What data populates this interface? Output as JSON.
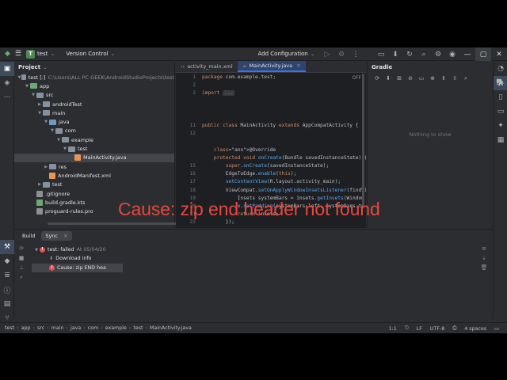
{
  "titlebar": {
    "project_badge": "T",
    "project_name": "test",
    "vcs": "Version Control",
    "run_config": "Add Configuration"
  },
  "project_panel": {
    "title": "Project",
    "tree": [
      {
        "label": "test [:]",
        "path": "C:\\Users\\ALL PC GEEK\\AndroidStudioProjects\\test",
        "indent": 0,
        "chevron": "▼",
        "icon": "folder"
      },
      {
        "label": "app",
        "indent": 1,
        "chevron": "▼",
        "icon": "folder-green"
      },
      {
        "label": "src",
        "indent": 2,
        "chevron": "▼",
        "icon": "folder"
      },
      {
        "label": "androidTest",
        "indent": 3,
        "chevron": "▶",
        "icon": "folder"
      },
      {
        "label": "main",
        "indent": 3,
        "chevron": "▼",
        "icon": "folder"
      },
      {
        "label": "java",
        "indent": 4,
        "chevron": "▼",
        "icon": "folder-blue"
      },
      {
        "label": "com",
        "indent": 5,
        "chevron": "▼",
        "icon": "folder"
      },
      {
        "label": "example",
        "indent": 6,
        "chevron": "▼",
        "icon": "folder"
      },
      {
        "label": "test",
        "indent": 7,
        "chevron": "▼",
        "icon": "folder"
      },
      {
        "label": "MainActivity.java",
        "indent": 8,
        "chevron": "",
        "icon": "java-file",
        "selected": true
      },
      {
        "label": "res",
        "indent": 4,
        "chevron": "▶",
        "icon": "folder"
      },
      {
        "label": "AndroidManifest.xml",
        "indent": 4,
        "chevron": "",
        "icon": "xml-file"
      },
      {
        "label": "test",
        "indent": 3,
        "chevron": "▶",
        "icon": "folder"
      },
      {
        "label": ".gitignore",
        "indent": 2,
        "chevron": "",
        "icon": "text-file"
      },
      {
        "label": "build.gradle.kts",
        "indent": 2,
        "chevron": "",
        "icon": "gradle-file"
      },
      {
        "label": "proguard-rules.pro",
        "indent": 2,
        "chevron": "",
        "icon": "text-file"
      }
    ]
  },
  "editor": {
    "tabs": [
      {
        "label": "activity_main.xml",
        "active": false
      },
      {
        "label": "MainActivity.java",
        "active": true
      }
    ],
    "off_label": "OFF",
    "line_numbers": [
      "1",
      "2",
      "3",
      "",
      "",
      "",
      "11",
      "12",
      "",
      "",
      "",
      "15",
      "16",
      "17",
      "18",
      "19",
      "20",
      "21",
      "22"
    ],
    "lines": [
      "package com.example.test;",
      "",
      "import ...",
      "",
      "",
      "",
      "public class MainActivity extends AppCompatActivity {",
      "",
      "",
      "    @Override",
      "    protected void onCreate(Bundle savedInstanceState) {",
      "        super.onCreate(savedInstanceState);",
      "        EdgeToEdge.enable(this);",
      "        setContentView(R.layout.activity_main);",
      "        ViewCompat.setOnApplyWindowInsetsListener(findVi",
      "            Insets systemBars = insets.getInsets(Window",
      "            v.setPadding(systemBars.left, systemBars.to",
      "            return insets;",
      "        });"
    ]
  },
  "gradle_panel": {
    "title": "Gradle",
    "empty_text": "Nothing to show"
  },
  "build_panel": {
    "tabs": [
      {
        "label": "Build"
      },
      {
        "label": "Sync"
      }
    ],
    "tree": [
      {
        "label": "test:",
        "status": "failed",
        "detail": "At 05/04/20",
        "indent": 0,
        "chevron": "▼",
        "icon": "error"
      },
      {
        "label": "Download info",
        "indent": 1,
        "chevron": "",
        "icon": "download"
      },
      {
        "label": "Cause: zip END hea",
        "indent": 1,
        "chevron": "",
        "icon": "error",
        "selected": true
      }
    ]
  },
  "overlay_caption": "Cause: zip end header not found",
  "statusbar": {
    "breadcrumbs": [
      "test",
      "app",
      "src",
      "main",
      "java",
      "com",
      "example",
      "test",
      "MainActivity.java"
    ],
    "position": "1:1",
    "line_sep": "LF",
    "encoding": "UTF-8",
    "indent": "4 spaces"
  },
  "colors": {
    "accent": "#3574f0",
    "error": "#e55353",
    "overlay_text": "#e8473f",
    "project_badge": "#4e8752"
  }
}
